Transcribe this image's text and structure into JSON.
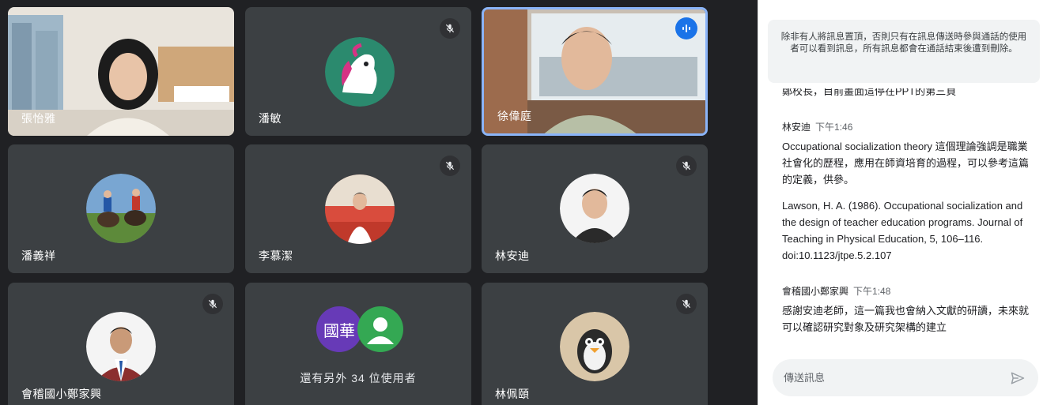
{
  "participants": [
    {
      "name": "張怡雅"
    },
    {
      "name": "潘敏"
    },
    {
      "name": "徐偉庭"
    },
    {
      "name": "潘義祥"
    },
    {
      "name": "李慕潔"
    },
    {
      "name": "林安迪"
    },
    {
      "name": "會稽國小鄭家興"
    },
    {
      "name": "林佩頤"
    }
  ],
  "group_tile": {
    "avatar_text": "國華",
    "more_text": "還有另外 34 位使用者"
  },
  "chat": {
    "notice": "除非有人將訊息置頂，否則只有在訊息傳送時參與通話的使用者可以看到訊息，所有訊息都會在通話結束後遭到刪除。",
    "cut_line": "鄭校長，目前畫面這停在PPT的第三頁",
    "messages": [
      {
        "sender": "林安迪",
        "time": "下午1:46",
        "texts": [
          "Occupational socialization theory 這個理論強調是職業社會化的歷程，應用在師資培育的過程，可以參考這篇的定義，供參。",
          "Lawson, H. A. (1986). Occupational socialization and the design of teacher education programs. Journal of Teaching in Physical Education, 5, 106–116. doi:10.1123/jtpe.5.2.107"
        ]
      },
      {
        "sender": "會稽國小鄭家興",
        "time": "下午1:48",
        "texts": [
          "感謝安迪老師，這一篇我也會納入文獻的研讀，未來就可以確認研究對象及研究架構的建立"
        ]
      }
    ],
    "input_placeholder": "傳送訊息"
  },
  "icons": {
    "mic_off": "mic-off-icon",
    "speaking": "speaking-indicator-icon",
    "send": "send-icon"
  },
  "colors": {
    "grid_bg": "#202124",
    "tile_bg": "#3c4043",
    "active_border": "#8ab4f8",
    "accent_blue": "#1a73e8",
    "group_avatar_purple": "#673ab7",
    "group_avatar_green": "#34a853"
  }
}
